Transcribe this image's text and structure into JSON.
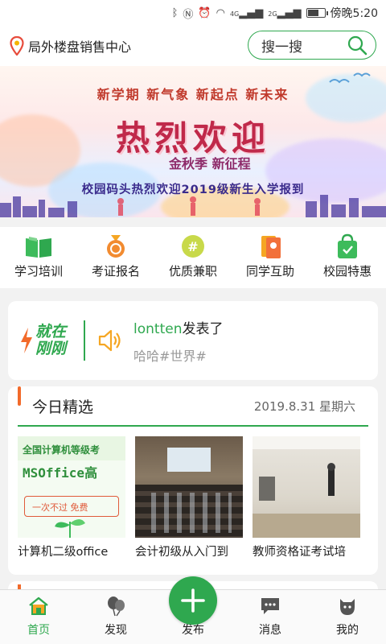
{
  "status_bar": {
    "time": "傍晚5:20",
    "signal_1": "4G",
    "signal_2": "2G"
  },
  "header": {
    "location": "局外楼盘销售中心",
    "search_placeholder": "搜一搜"
  },
  "banner": {
    "subtitle": "新学期  新气象  新起点  新未来",
    "title": "热烈欢迎",
    "tagline": "金秋季  新征程",
    "caption": "校园码头热烈欢迎2019级新生入学报到"
  },
  "categories": [
    {
      "label": "学习培训",
      "icon": "book-icon"
    },
    {
      "label": "考证报名",
      "icon": "medal-icon"
    },
    {
      "label": "优质兼职",
      "icon": "hashtag-badge-icon"
    },
    {
      "label": "同学互助",
      "icon": "cards-icon"
    },
    {
      "label": "校园特惠",
      "icon": "shopping-bag-icon"
    }
  ],
  "news": {
    "badge": "就在刚刚",
    "user": "lontten",
    "action": "发表了",
    "content": "哈哈#世界#"
  },
  "featured": {
    "title": "今日精选",
    "date": "2019.8.31  星期六",
    "items": [
      {
        "caption": "计算机二级office",
        "thumb_text_1": "全国计算机等级考",
        "thumb_text_2": "MSOffice高",
        "thumb_text_3": "一次不过  免费"
      },
      {
        "caption": "会计初级从入门到"
      },
      {
        "caption": "教师资格证考试培"
      }
    ]
  },
  "tabbar": {
    "items": [
      {
        "label": "首页",
        "icon": "home-icon",
        "active": true
      },
      {
        "label": "发现",
        "icon": "balloon-icon",
        "active": false
      },
      {
        "label": "发布",
        "icon": "plus-icon",
        "active": false
      },
      {
        "label": "消息",
        "icon": "message-icon",
        "active": false
      },
      {
        "label": "我的",
        "icon": "profile-icon",
        "active": false
      }
    ]
  },
  "colors": {
    "accent": "#2fa84f",
    "highlight": "#f26a2a"
  }
}
